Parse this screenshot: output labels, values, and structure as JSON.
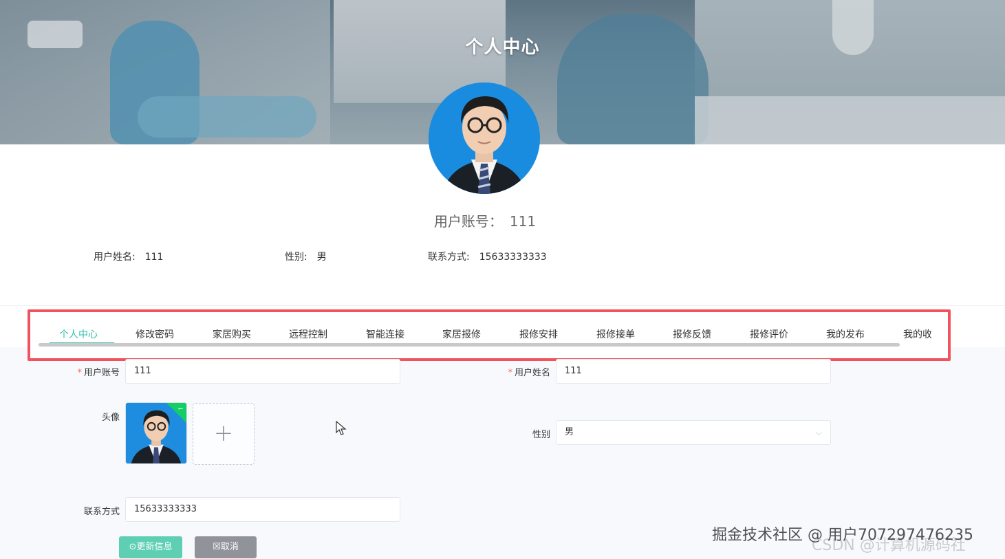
{
  "header": {
    "title": "个人中心"
  },
  "profile": {
    "account_label": "用户账号：",
    "account_value": "111",
    "name_label": "用户姓名:",
    "name_value": "111",
    "gender_label": "性别:",
    "gender_value": "男",
    "phone_label": "联系方式:",
    "phone_value": "15633333333"
  },
  "tabs": {
    "items": [
      {
        "label": "个人中心",
        "active": true
      },
      {
        "label": "修改密码"
      },
      {
        "label": "家居购买"
      },
      {
        "label": "远程控制"
      },
      {
        "label": "智能连接"
      },
      {
        "label": "家居报修"
      },
      {
        "label": "报修安排"
      },
      {
        "label": "报修接单"
      },
      {
        "label": "报修反馈"
      },
      {
        "label": "报修评价"
      },
      {
        "label": "我的发布"
      },
      {
        "label": "我的收"
      }
    ],
    "highlight_color": "#f0535c",
    "active_color": "#31c0a8"
  },
  "form": {
    "account_label": "用户账号",
    "account_value": "111",
    "name_label": "用户姓名",
    "name_value": "111",
    "avatar_label": "头像",
    "upload_add_icon": "+",
    "gender_label": "性别",
    "gender_value": "男",
    "phone_label": "联系方式",
    "phone_value": "15633333333",
    "update_button": "⊙更新信息",
    "cancel_button": "☒取消",
    "required_mark": "*"
  },
  "watermark": {
    "primary": "掘金技术社区 @ 用户707297476235",
    "secondary": "CSDN @计算机源码社"
  }
}
